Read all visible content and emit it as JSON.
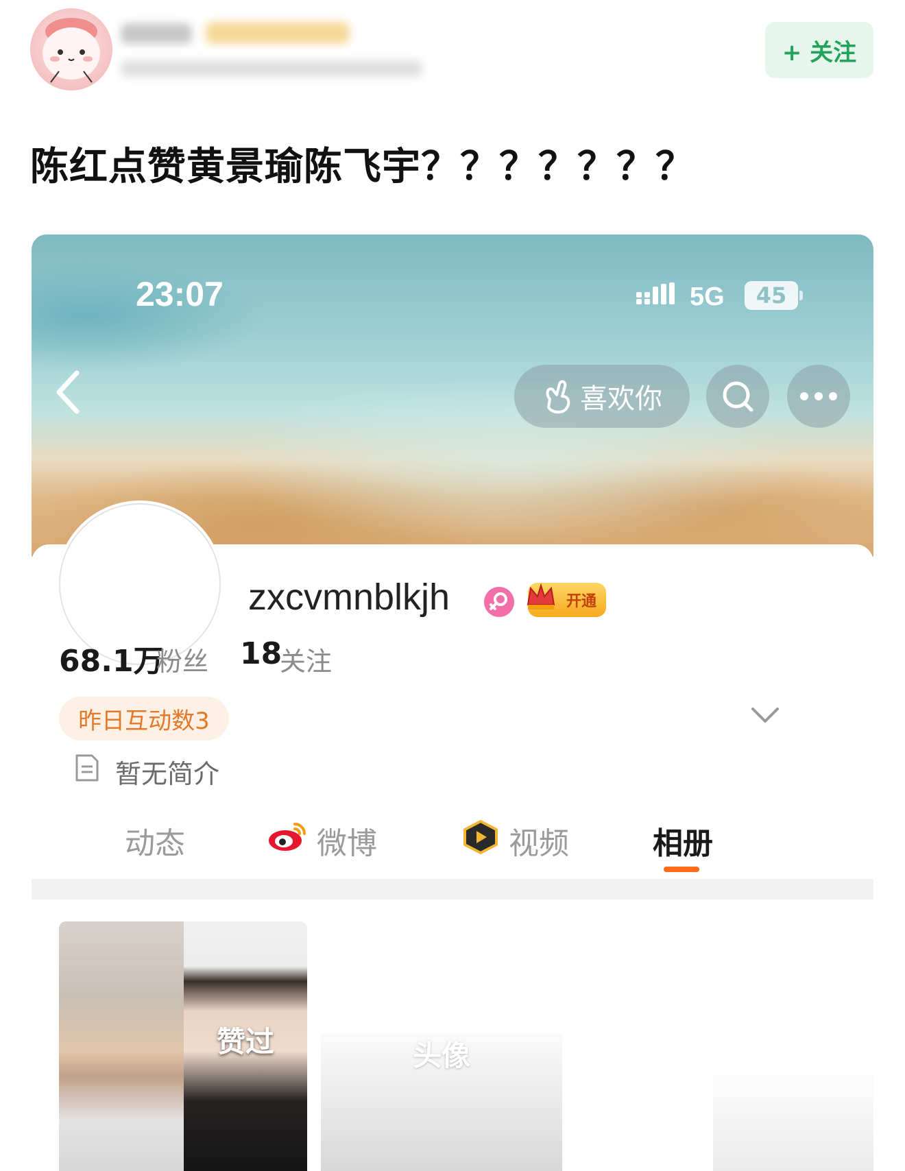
{
  "post": {
    "follow_label": "+ 关注",
    "text": "陈红点赞黄景瑜陈飞宇？？？？？？？"
  },
  "status_bar": {
    "time": "23:07",
    "network": "5G",
    "battery": "45"
  },
  "nav": {
    "like_label": "喜欢你"
  },
  "profile": {
    "username": "zxcvmnblkjh",
    "vip_label": "开通",
    "fans_count": "68.1万",
    "fans_label": "粉丝",
    "follow_count": "18",
    "follow_label": "关注",
    "interaction_badge": "昨日互动数3",
    "intro": "暂无简介"
  },
  "tabs": [
    {
      "label": "动态"
    },
    {
      "label": "微博"
    },
    {
      "label": "视频"
    },
    {
      "label": "相册"
    }
  ],
  "active_tab": "相册",
  "album": {
    "liked_label": "赞过",
    "avatar_label": "头像"
  },
  "colors": {
    "follow_green": "#23a35a",
    "accent_orange": "#ff6b1a",
    "badge_orange": "#e4792a"
  }
}
